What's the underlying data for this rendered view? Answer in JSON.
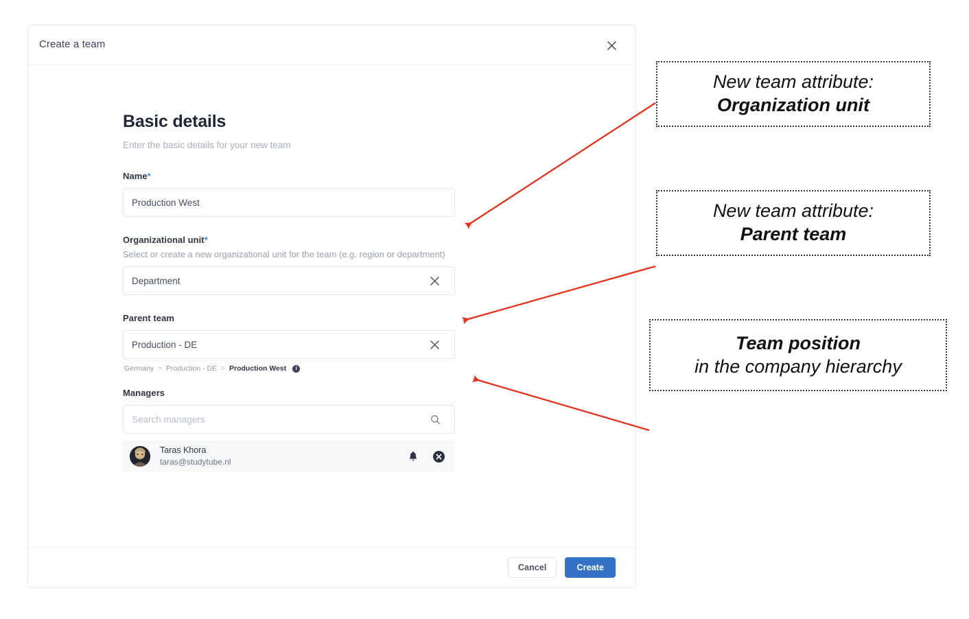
{
  "dialog": {
    "title": "Create a team",
    "close_icon": "close-icon",
    "section": {
      "heading": "Basic details",
      "subheading": "Enter the basic details for your new team"
    },
    "fields": {
      "name": {
        "label": "Name",
        "required_marker": "*",
        "value": "Production West"
      },
      "org_unit": {
        "label": "Organizational unit",
        "required_marker": "*",
        "help": "Select or create a new organizational unit for the team (e.g. region or department)",
        "value": "Department",
        "clear_icon": "close-icon"
      },
      "parent_team": {
        "label": "Parent team",
        "value": "Production - DE",
        "clear_icon": "close-icon"
      },
      "managers": {
        "label": "Managers",
        "search_placeholder": "Search managers",
        "search_value": "",
        "search_icon": "search-icon"
      }
    },
    "breadcrumb": {
      "items": [
        "Germany",
        "Production - DE",
        "Production West"
      ],
      "separator": ">",
      "info_icon": "info-icon",
      "info_glyph": "i"
    },
    "manager_list": [
      {
        "name": "Taras Khora",
        "email": "taras@studytube.nl",
        "bell_icon": "bell-icon",
        "remove_icon": "remove-circle-icon"
      }
    ],
    "footer": {
      "cancel_label": "Cancel",
      "create_label": "Create"
    }
  },
  "annotations": [
    {
      "id": "org",
      "line1": "New team attribute:",
      "line2": "Organization unit"
    },
    {
      "id": "parent",
      "line1": "New team attribute:",
      "line2": "Parent team"
    },
    {
      "id": "position",
      "line1": "Team position",
      "line2": "in the company hierarchy"
    }
  ],
  "colors": {
    "accent_blue": "#3372c4",
    "required_blue": "#3b8fe8",
    "arrow_red": "#e8301c",
    "annotation_border": "#333333",
    "row_background": "#f7f8fa"
  }
}
